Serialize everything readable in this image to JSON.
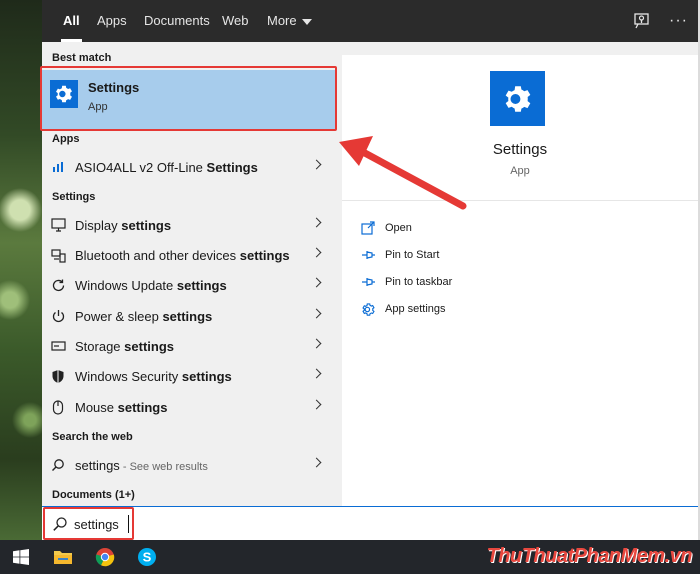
{
  "tabs": [
    {
      "label": "All",
      "active": true
    },
    {
      "label": "Apps"
    },
    {
      "label": "Documents"
    },
    {
      "label": "Web"
    },
    {
      "label": "More"
    }
  ],
  "top_icons": [
    "feedback-icon",
    "more-options-icon"
  ],
  "more_dots": "···",
  "sections": {
    "best_match": "Best match",
    "apps": "Apps",
    "settings": "Settings",
    "search_web": "Search the web",
    "documents": "Documents (1+)"
  },
  "best_match": {
    "title": "Settings",
    "subtitle": "App"
  },
  "apps": [
    {
      "prefix": "ASIO4ALL v2 Off-Line ",
      "bold": "Settings",
      "icon": "asio-icon"
    }
  ],
  "settings_items": [
    {
      "prefix": "Display ",
      "bold": "settings",
      "icon": "display-icon"
    },
    {
      "prefix": "Bluetooth and other devices ",
      "bold": "settings",
      "icon": "bluetooth-icon"
    },
    {
      "prefix": "Windows Update ",
      "bold": "settings",
      "icon": "update-icon"
    },
    {
      "prefix": "Power & sleep ",
      "bold": "settings",
      "icon": "power-icon"
    },
    {
      "prefix": "Storage ",
      "bold": "settings",
      "icon": "storage-icon"
    },
    {
      "prefix": "Windows Security ",
      "bold": "settings",
      "icon": "shield-icon"
    },
    {
      "prefix": "Mouse ",
      "bold": "settings",
      "icon": "mouse-icon"
    }
  ],
  "web": {
    "query": "settings",
    "hint": " - See web results"
  },
  "preview": {
    "title": "Settings",
    "subtitle": "App",
    "actions": [
      {
        "label": "Open",
        "icon": "open-icon"
      },
      {
        "label": "Pin to Start",
        "icon": "pin-icon"
      },
      {
        "label": "Pin to taskbar",
        "icon": "pin-icon"
      },
      {
        "label": "App settings",
        "icon": "gear-icon"
      }
    ]
  },
  "search": {
    "value": "settings"
  },
  "taskbar": [
    "windows-start-icon",
    "file-explorer-icon",
    "chrome-icon",
    "skype-icon"
  ],
  "watermark": "ThuThuatPhanMem.vn",
  "colors": {
    "accent": "#0a6cd4",
    "selection": "#a7ccec",
    "highlight_border": "#e53935"
  }
}
